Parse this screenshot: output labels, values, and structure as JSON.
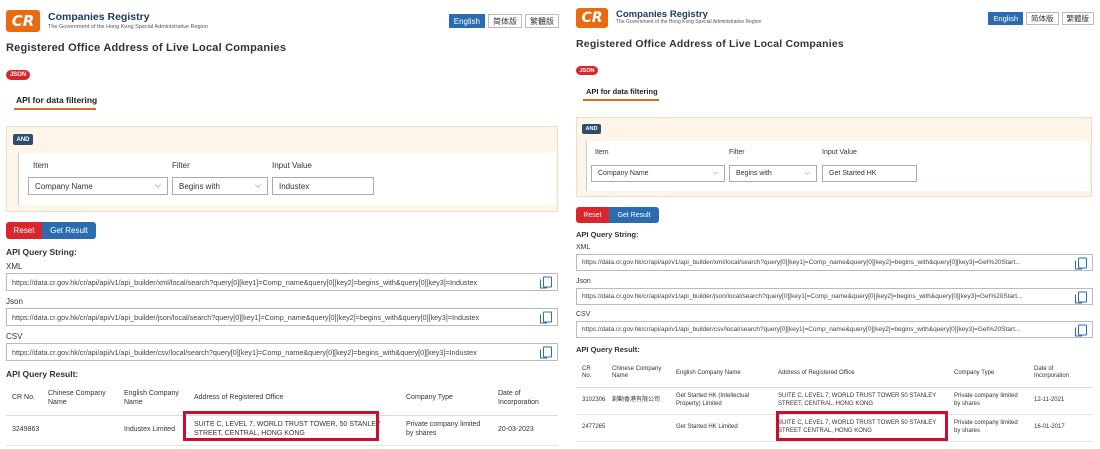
{
  "header": {
    "logo_text": "CR",
    "title": "Companies Registry",
    "subtitle": "The Government of the Hong Kong Special Administrative Region",
    "languages": [
      "English",
      "简体版",
      "繁體版"
    ]
  },
  "page_title": "Registered Office Address of Live Local Companies",
  "json_badge": "JSON",
  "tab_label": "API for data filtering",
  "filter": {
    "and_label": "AND",
    "item_label": "Item",
    "filter_label": "Filter",
    "input_label": "Input Value"
  },
  "buttons": {
    "reset": "Reset",
    "get_result": "Get Result"
  },
  "query_string_heading": "API Query String:",
  "query_result_heading": "API Query Result:",
  "table_headers": [
    "CR No.",
    "Chinese Company Name",
    "English Company Name",
    "Address of Registered Office",
    "Company Type",
    "Date of Incorporation"
  ],
  "left": {
    "item_value": "Company Name",
    "filter_value": "Begins with",
    "input_value": "Industex",
    "queries": [
      {
        "format": "XML",
        "url": "https://data.cr.gov.hk/cr/api/api/v1/api_builder/xml/local/search?query[0][key1]=Comp_name&query[0][key2]=begins_with&query[0][key3]=Industex"
      },
      {
        "format": "Json",
        "url": "https://data.cr.gov.hk/cr/api/api/v1/api_builder/json/local/search?query[0][key1]=Comp_name&query[0][key2]=begins_with&query[0][key3]=Industex"
      },
      {
        "format": "CSV",
        "url": "https://data.cr.gov.hk/cr/api/api/v1/api_builder/csv/local/search?query[0][key1]=Comp_name&query[0][key2]=begins_with&query[0][key3]=Industex"
      }
    ],
    "rows": [
      {
        "cr_no": "3249863",
        "chinese_name": "",
        "english_name": "Industex Limited",
        "address": "SUITE C, LEVEL 7, WORLD TRUST TOWER, 50 STANLEY STREET, CENTRAL, HONG KONG",
        "type": "Private company limited by shares",
        "date": "20-03-2023"
      }
    ]
  },
  "right": {
    "item_value": "Company Name",
    "filter_value": "Begins with",
    "input_value": "Get Started HK",
    "queries": [
      {
        "format": "XML",
        "url": "https://data.cr.gov.hk/cr/api/api/v1/api_builder/xml/local/search?query[0][key1]=Comp_name&query[0][key2]=begins_with&query[0][key3]=Get%20Start..."
      },
      {
        "format": "Json",
        "url": "https://data.cr.gov.hk/cr/api/api/v1/api_builder/json/local/search?query[0][key1]=Comp_name&query[0][key2]=begins_with&query[0][key3]=Get%20Start..."
      },
      {
        "format": "CSV",
        "url": "https://data.cr.gov.hk/cr/api/api/v1/api_builder/csv/local/search?query[0][key1]=Comp_name&query[0][key2]=begins_with&query[0][key3]=Get%20Start..."
      }
    ],
    "rows": [
      {
        "cr_no": "3102306",
        "chinese_name": "創動香港有限公司",
        "english_name": "Get Started HK (Intellectual Property) Limited",
        "address": "SUITE C, LEVEL 7, WORLD TRUST TOWER 50 STANLEY STREET, CENTRAL, HONG KONG",
        "type": "Private company limited by shares",
        "date": "12-11-2021"
      },
      {
        "cr_no": "2477265",
        "chinese_name": "",
        "english_name": "Get Started HK Limited",
        "address": "SUITE C, LEVEL 7, WORLD TRUST TOWER 50 STANLEY STREET CENTRAL, HONG KONG",
        "type": "Private company limited by shares",
        "date": "16-01-2017"
      }
    ]
  },
  "colors": {
    "brand_orange": "#ea6a10",
    "accent_blue": "#2b6cb0",
    "danger_red": "#d9262c",
    "highlight_red": "#c8102e"
  }
}
